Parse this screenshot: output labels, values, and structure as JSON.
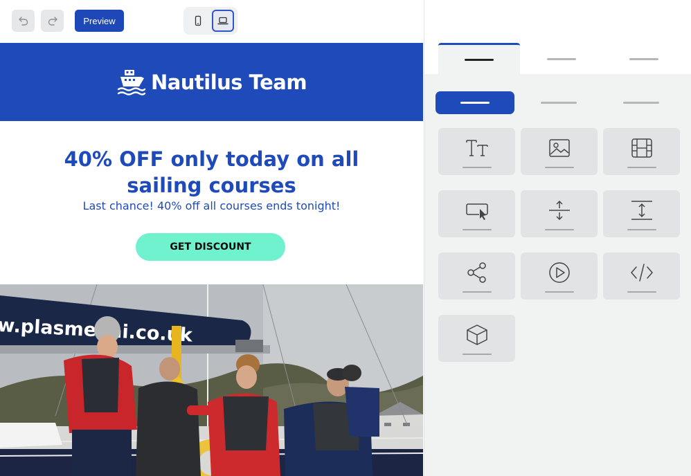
{
  "toolbar": {
    "undo_icon": "undo-icon",
    "redo_icon": "redo-icon",
    "preview_label": "Preview",
    "devices": [
      {
        "name": "mobile",
        "icon": "phone-icon",
        "active": false
      },
      {
        "name": "desktop",
        "icon": "laptop-icon",
        "active": true
      }
    ]
  },
  "email": {
    "brand_icon": "ship-icon",
    "brand_name": "Nautilus Team",
    "headline_line1": "40% OFF only today on all",
    "headline_line2": "sailing courses",
    "subline": "Last chance! 40% off all courses ends tonight!",
    "cta_label": "GET DISCOUNT",
    "photo_sail_text": "w.plasmenai.co.uk"
  },
  "panel": {
    "main_tabs": [
      {
        "active": true
      },
      {
        "active": false
      },
      {
        "active": false
      }
    ],
    "sub_tabs": [
      {
        "active": true
      },
      {
        "active": false
      },
      {
        "active": false
      }
    ],
    "blocks": [
      {
        "icon": "text-icon"
      },
      {
        "icon": "image-icon"
      },
      {
        "icon": "video-film-icon"
      },
      {
        "icon": "button-icon"
      },
      {
        "icon": "spacer-icon"
      },
      {
        "icon": "divider-icon"
      },
      {
        "icon": "social-share-icon"
      },
      {
        "icon": "play-icon"
      },
      {
        "icon": "html-code-icon"
      },
      {
        "icon": "cube-icon"
      }
    ]
  },
  "colors": {
    "brand_blue": "#1f4ab9",
    "cta_green": "#6ff2cd",
    "panel_bg": "#f1f2f2",
    "tile_bg": "#e2e3e4"
  }
}
